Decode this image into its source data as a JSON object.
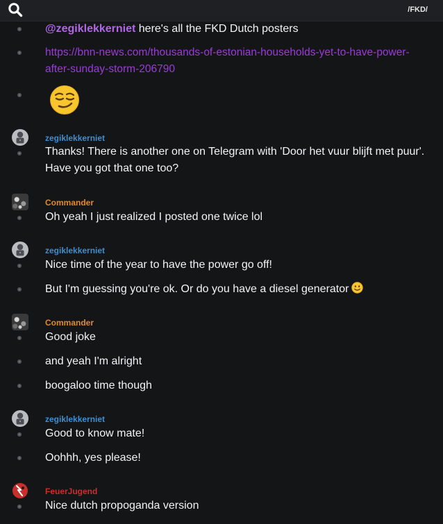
{
  "header": {
    "board_tag": "/FKD/",
    "search_icon": "search-icon"
  },
  "colors": {
    "zegiklekkerniet": "#3f8fd0",
    "Commander": "#e08a2c",
    "FeuerJugend": "#c9302c"
  },
  "messages": [
    {
      "mention": "@zegiklekkerniet",
      "text": " here's all the FKD Dutch posters"
    },
    {
      "link": "https://bnn-news.com/thousands-of-estonian-households-yet-to-have-power-after-sunday-storm-206790"
    },
    {
      "emoji": "smirking-face"
    },
    {
      "username": "zegiklekkerniet",
      "text": "Thanks! There is another one on Telegram with 'Door het vuur blijft met puur'. Have you got that one too?"
    },
    {
      "username": "Commander",
      "text": "Oh yeah I just realized I posted one twice lol"
    },
    {
      "username": "zegiklekkerniet",
      "text": "Nice time of the year to have the power go off!"
    },
    {
      "text": "But I'm guessing you're ok. Or do you have a diesel generator",
      "emoji": "slightly-smiling-face"
    },
    {
      "username": "Commander",
      "text": "Good joke"
    },
    {
      "text": "and yeah I'm alright"
    },
    {
      "text": "boogaloo time though"
    },
    {
      "username": "zegiklekkerniet",
      "text": "Good to know mate!"
    },
    {
      "text": "Oohhh, yes please!"
    },
    {
      "username": "FeuerJugend",
      "text": "Nice dutch propoganda version"
    }
  ]
}
